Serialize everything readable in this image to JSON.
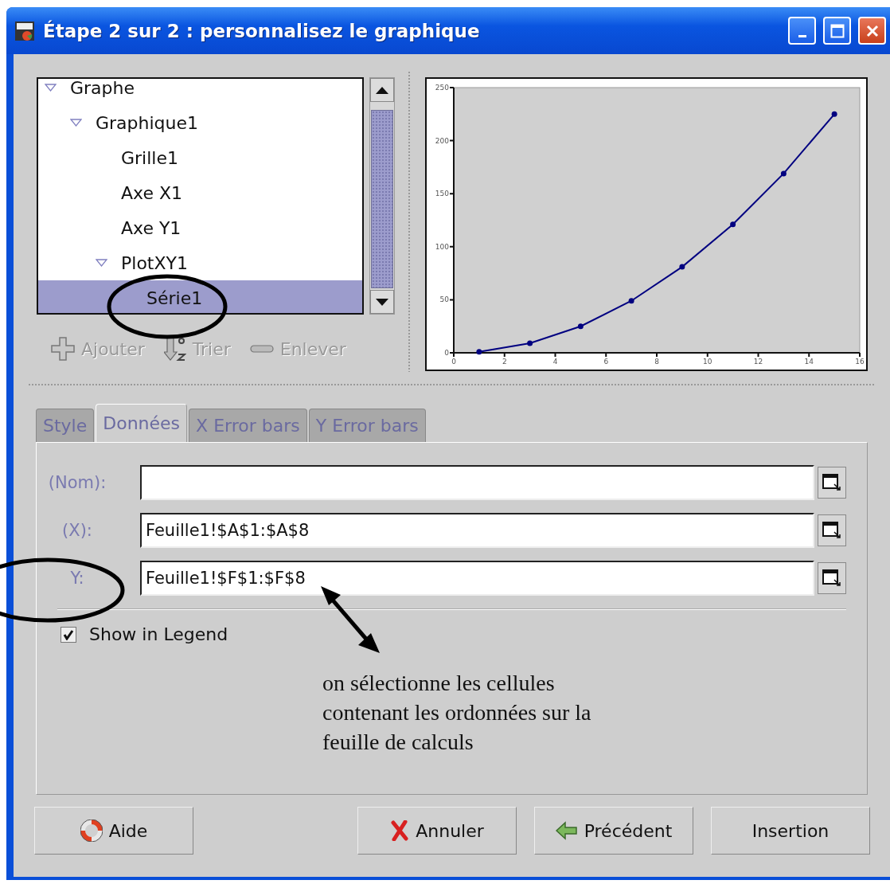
{
  "window": {
    "title": "Étape 2 sur 2 : personnalisez le graphique"
  },
  "tree": {
    "items": [
      {
        "label": "Graphe",
        "expanded": true,
        "selected": false,
        "children": [
          {
            "label": "Graphique1",
            "expanded": true,
            "selected": false,
            "children": [
              {
                "label": "Grille1",
                "selected": false
              },
              {
                "label": "Axe X1",
                "selected": false
              },
              {
                "label": "Axe Y1",
                "selected": false
              },
              {
                "label": "PlotXY1",
                "expanded": true,
                "selected": false,
                "children": [
                  {
                    "label": "Série1",
                    "selected": true
                  }
                ]
              }
            ]
          }
        ]
      }
    ]
  },
  "tree_toolbar": [
    {
      "kind": "add",
      "label": "Ajouter",
      "disabled": true
    },
    {
      "kind": "sort",
      "label": "Trier",
      "disabled": true
    },
    {
      "kind": "remove",
      "label": "Enlever",
      "disabled": true
    }
  ],
  "chart": {
    "chart_data": {
      "type": "line",
      "x": [
        1,
        3,
        5,
        7,
        9,
        11,
        13,
        15
      ],
      "series": [
        {
          "color": "#000080",
          "marker": "circle",
          "values": [
            1,
            9,
            25,
            49,
            81,
            121,
            169,
            225
          ]
        }
      ],
      "xlim": [
        0,
        16
      ],
      "ylim": [
        0,
        250
      ],
      "xticks": [
        0,
        2,
        4,
        6,
        8,
        10,
        12,
        14,
        16
      ],
      "yticks": [
        0,
        50,
        100,
        150,
        200,
        250
      ]
    }
  },
  "tabs": [
    {
      "label": "Style",
      "selected": false
    },
    {
      "label": "Données",
      "selected": true
    },
    {
      "label": "X Error bars",
      "selected": false
    },
    {
      "label": "Y Error bars",
      "selected": false
    }
  ],
  "fields": [
    {
      "label": "(Nom):"
    },
    {
      "label": "(X):",
      "value": "Feuille1!$A$1:$A$8"
    },
    {
      "label": "Y:",
      "value": "Feuille1!$F$1:$F$8"
    }
  ],
  "show_in_legend": {
    "label": "Show in Legend",
    "checked": true
  },
  "annotation": {
    "text": " on sélectionne les cellules\ncontenant les ordonnées  sur la\nfeuille de calculs"
  },
  "buttons": [
    {
      "kind": "help",
      "label": "Aide"
    },
    {
      "kind": "cancel",
      "label": "Annuler"
    },
    {
      "kind": "back",
      "label": "Précédent"
    },
    {
      "kind": "insert",
      "label": "Insertion"
    }
  ]
}
